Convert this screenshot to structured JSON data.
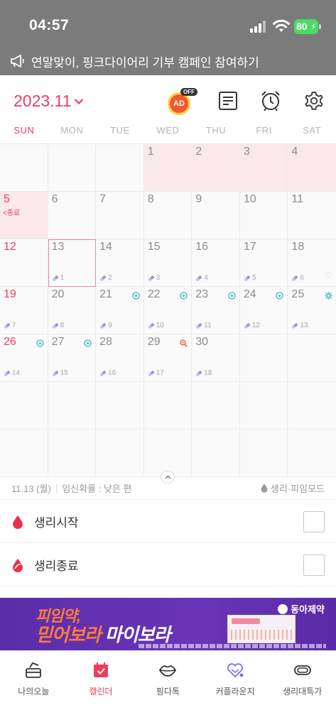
{
  "status_bar": {
    "time": "04:57",
    "battery": "80"
  },
  "announcement": {
    "text": "연말맞이, 핑크다이어리 기부 캠페인 참여하기"
  },
  "header": {
    "month_label": "2023.11",
    "ad_label": "AD",
    "ad_off_badge": "OFF"
  },
  "weekdays": [
    "SUN",
    "MON",
    "TUE",
    "WED",
    "THU",
    "FRI",
    "SAT"
  ],
  "calendar": {
    "days": [
      {
        "n": "",
        "bg": ""
      },
      {
        "n": "",
        "bg": ""
      },
      {
        "n": "",
        "bg": ""
      },
      {
        "n": "1",
        "bg": "period"
      },
      {
        "n": "2",
        "bg": "period"
      },
      {
        "n": "3",
        "bg": "period"
      },
      {
        "n": "4",
        "bg": "period"
      },
      {
        "n": "5",
        "bg": "period",
        "sun": true,
        "note": "<종료"
      },
      {
        "n": "6"
      },
      {
        "n": "7"
      },
      {
        "n": "8"
      },
      {
        "n": "9"
      },
      {
        "n": "10"
      },
      {
        "n": "11"
      },
      {
        "n": "12",
        "sun": true
      },
      {
        "n": "13",
        "selected": true,
        "pill": "1"
      },
      {
        "n": "14",
        "pill": "2"
      },
      {
        "n": "15",
        "pill": "3"
      },
      {
        "n": "16",
        "pill": "4"
      },
      {
        "n": "17",
        "pill": "5"
      },
      {
        "n": "18",
        "pill": "6",
        "heart": true
      },
      {
        "n": "19",
        "sun": true,
        "pill": "7"
      },
      {
        "n": "20",
        "pill": "8"
      },
      {
        "n": "21",
        "pill": "9",
        "mark": "fertile"
      },
      {
        "n": "22",
        "pill": "10",
        "mark": "fertile"
      },
      {
        "n": "23",
        "pill": "11",
        "mark": "fertile"
      },
      {
        "n": "24",
        "pill": "12",
        "mark": "fertile"
      },
      {
        "n": "25",
        "pill": "13",
        "mark": "ovulation"
      },
      {
        "n": "26",
        "sun": true,
        "pill": "14",
        "mark": "fertile"
      },
      {
        "n": "27",
        "pill": "15",
        "mark": "fertile"
      },
      {
        "n": "28",
        "pill": "16"
      },
      {
        "n": "29",
        "pill": "17",
        "mark": "search"
      },
      {
        "n": "30",
        "pill": "18"
      },
      {
        "n": ""
      },
      {
        "n": ""
      },
      {
        "n": ""
      },
      {
        "n": ""
      },
      {
        "n": ""
      },
      {
        "n": ""
      },
      {
        "n": ""
      },
      {
        "n": ""
      },
      {
        "n": ""
      },
      {
        "n": ""
      },
      {
        "n": ""
      },
      {
        "n": ""
      },
      {
        "n": ""
      },
      {
        "n": ""
      },
      {
        "n": ""
      },
      {
        "n": ""
      }
    ]
  },
  "detail": {
    "date": "11.13 (월)",
    "probability": "임신확률 : 낮은 편",
    "mode": "생리·피임모드",
    "options": [
      {
        "label": "생리시작"
      },
      {
        "label": "생리종료"
      }
    ]
  },
  "ad_banner": {
    "line1": "피임약,",
    "line2_a": "믿어보라 ",
    "line2_b": "마이보라",
    "brand": "동아제약"
  },
  "tabs": [
    {
      "label": "나의오늘",
      "icon": "today-icon"
    },
    {
      "label": "캘린더",
      "icon": "calendar-icon",
      "active": true
    },
    {
      "label": "핑다톡",
      "icon": "lips-icon"
    },
    {
      "label": "커플라운지",
      "icon": "couple-heart-icon"
    },
    {
      "label": "생리대특가",
      "icon": "pad-icon"
    }
  ],
  "colors": {
    "accent": "#ee3e5e",
    "period_bg": "#fbe8e9",
    "fertile": "#5ac8b8",
    "pill": "#9b8fe0"
  }
}
